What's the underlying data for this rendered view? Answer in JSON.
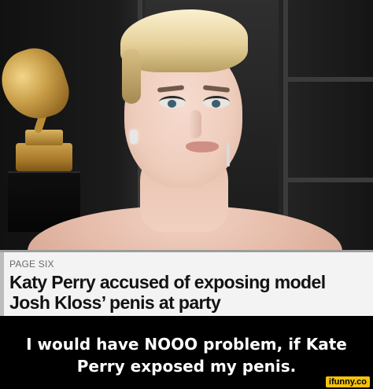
{
  "article": {
    "source": "PAGE SIX",
    "headline_line1": "Katy Perry accused of exposing model",
    "headline_line2": "Josh Kloss’ penis at party"
  },
  "caption": {
    "line1": "I would have NOOO problem, if Kate",
    "line2": "Perry exposed my penis."
  },
  "watermark": {
    "text": "ifunny.co"
  },
  "colors": {
    "caption_bg": "#000000",
    "card_bg": "#f3f3f3",
    "watermark_bg": "#f4c20d"
  },
  "icons": {
    "trophy": "gramophone-trophy-icon"
  }
}
